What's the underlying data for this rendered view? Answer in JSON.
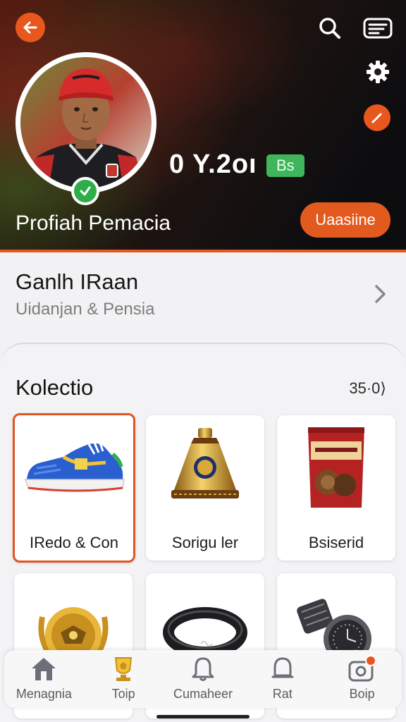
{
  "header": {
    "profile_name": "Profiah Pemacia",
    "stat_value": "0 Y.2oı",
    "stat_badge": "Bs",
    "follow_label": "Uaasiine",
    "icons": [
      "back-arrow-icon",
      "search-icon",
      "message-icon",
      "gear-icon",
      "edit-icon",
      "verified-icon"
    ],
    "accent_color": "#e8571e"
  },
  "info": {
    "title": "Ganlh IRaan",
    "subtitle": "Uidanjan & Pensia"
  },
  "collection": {
    "title": "Kolectio",
    "count": "35·0⟩",
    "items": [
      {
        "label": "IRedo  & Con",
        "icon": "sneaker-icon",
        "selected": true
      },
      {
        "label": "Sorigu ler",
        "icon": "golden-bell-icon",
        "selected": false
      },
      {
        "label": "Bsiserid",
        "icon": "snack-bag-icon",
        "selected": false
      },
      {
        "label": "",
        "icon": "gold-medal-icon",
        "selected": false
      },
      {
        "label": "",
        "icon": "black-ring-icon",
        "selected": false
      },
      {
        "label": "",
        "icon": "watch-icon",
        "selected": false
      }
    ]
  },
  "nav": {
    "items": [
      {
        "label": "Menagnia",
        "icon": "home-icon"
      },
      {
        "label": "Toip",
        "icon": "trophy-icon"
      },
      {
        "label": "Cumaheer",
        "icon": "bell-icon"
      },
      {
        "label": "Rat",
        "icon": "bell-outline-icon"
      },
      {
        "label": "Boip",
        "icon": "camera-icon"
      }
    ]
  }
}
